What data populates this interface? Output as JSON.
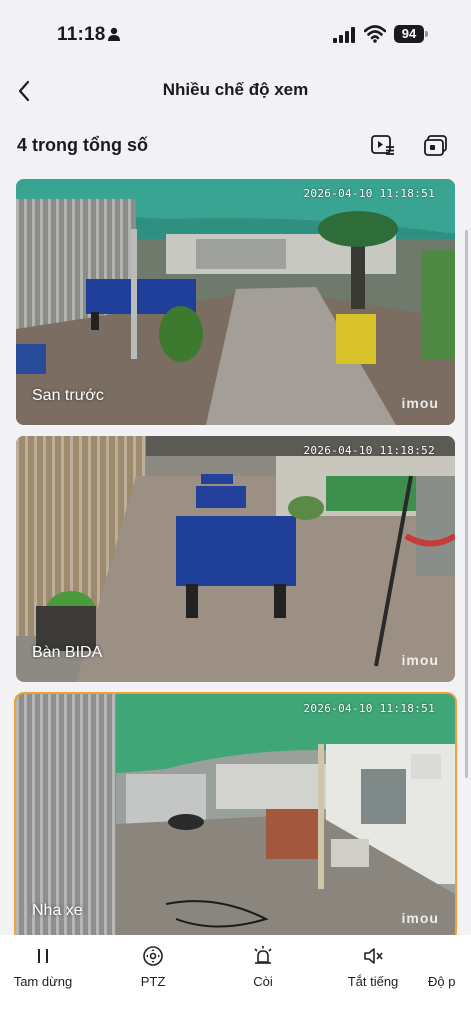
{
  "status_bar": {
    "time": "11:18",
    "battery": "94"
  },
  "header": {
    "title": "Nhiều chế độ xem"
  },
  "summary": {
    "count_label": "4 trong tổng số"
  },
  "cameras": [
    {
      "name": "San trước",
      "timestamp": "2026-04-10 11:18:51",
      "brand": "imou"
    },
    {
      "name": "Bàn BIDA",
      "timestamp": "2026-04-10 11:18:52",
      "brand": "imou"
    },
    {
      "name": "Nha xe",
      "timestamp": "2026-04-10 11:18:51",
      "brand": "imou"
    }
  ],
  "toolbar": {
    "items": [
      {
        "label": "Tam dừng",
        "icon": "pause-icon"
      },
      {
        "label": "PTZ",
        "icon": "ptz-icon"
      },
      {
        "label": "Còi",
        "icon": "siren-icon"
      },
      {
        "label": "Tắt tiếng",
        "icon": "mute-icon"
      },
      {
        "label": "Độ p",
        "icon": "resolution-icon"
      }
    ]
  },
  "colors": {
    "accent_selected": "#f0a13a",
    "background": "#f2f2f4"
  }
}
